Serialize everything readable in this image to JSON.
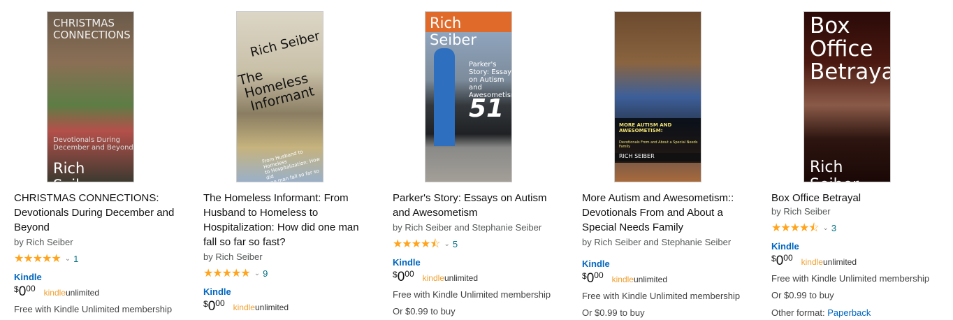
{
  "books": [
    {
      "cover_lines": [
        "CHRISTMAS",
        "CONNECTIONS",
        "Devotionals During",
        "December and Beyond",
        "Rich Seiber"
      ],
      "title": "CHRISTMAS CONNECTIONS: Devotionals During December and Beyond",
      "author": "by Rich Seiber",
      "stars": "★★★★★",
      "rating_count": "1",
      "format": "Kindle",
      "price_currency": "$",
      "price_whole": "0",
      "price_frac": "00",
      "ku_kindle": "kindle",
      "ku_unlimited": "unlimited",
      "free_text": "Free with Kindle Unlimited membership"
    },
    {
      "cover_lines": [
        "Rich Seiber",
        "The",
        "Homeless",
        "Informant",
        "From Husband to Homeless",
        "to Hospitalization: How did",
        "one man fall so far so fast?"
      ],
      "title": "The Homeless Informant: From Husband to Homeless to Hospitalization: How did one man fall so far so fast?",
      "author": "by Rich Seiber",
      "stars": "★★★★★",
      "rating_count": "9",
      "format": "Kindle",
      "price_currency": "$",
      "price_whole": "0",
      "price_frac": "00",
      "ku_kindle": "kindle",
      "ku_unlimited": "unlimited"
    },
    {
      "cover_lines": [
        "Rich Seiber",
        "Parker's",
        "Story: Essays",
        "on Autism and",
        "Awesometism",
        "51"
      ],
      "title": "Parker's Story: Essays on Autism and Awesometism",
      "author": "by Rich Seiber and Stephanie Seiber",
      "stars": "★★★★⯪",
      "rating_count": "5",
      "format": "Kindle",
      "price_currency": "$",
      "price_whole": "0",
      "price_frac": "00",
      "ku_kindle": "kindle",
      "ku_unlimited": "unlimited",
      "free_text": "Free with Kindle Unlimited membership",
      "buy_text": "Or $0.99 to buy"
    },
    {
      "cover_lines": [
        "MORE AUTISM AND AWESOMETISM:",
        "Devotionals From and About a Special Needs",
        "Family",
        "RICH SEIBER"
      ],
      "title": "More Autism and Awesometism:: Devotionals From and About a Special Needs Family",
      "author": "by Rich Seiber and Stephanie Seiber",
      "format": "Kindle",
      "price_currency": "$",
      "price_whole": "0",
      "price_frac": "00",
      "ku_kindle": "kindle",
      "ku_unlimited": "unlimited",
      "free_text": "Free with Kindle Unlimited membership",
      "buy_text": "Or $0.99 to buy"
    },
    {
      "cover_lines": [
        "Box",
        "Office",
        "Betrayal",
        "Rich Seiber"
      ],
      "title": "Box Office Betrayal",
      "author": "by Rich Seiber",
      "stars": "★★★★⯪",
      "rating_count": "3",
      "format": "Kindle",
      "price_currency": "$",
      "price_whole": "0",
      "price_frac": "00",
      "ku_kindle": "kindle",
      "ku_unlimited": "unlimited",
      "free_text": "Free with Kindle Unlimited membership",
      "buy_text": "Or $0.99 to buy",
      "other_label": "Other format:",
      "other_link": "Paperback"
    }
  ],
  "icons": {
    "star": "star-icon",
    "chevron": "chevron-down-icon"
  },
  "colors": {
    "link": "#007185",
    "format": "#0066c0",
    "star": "#ffa41c",
    "ku_orange": "#f0a030"
  }
}
